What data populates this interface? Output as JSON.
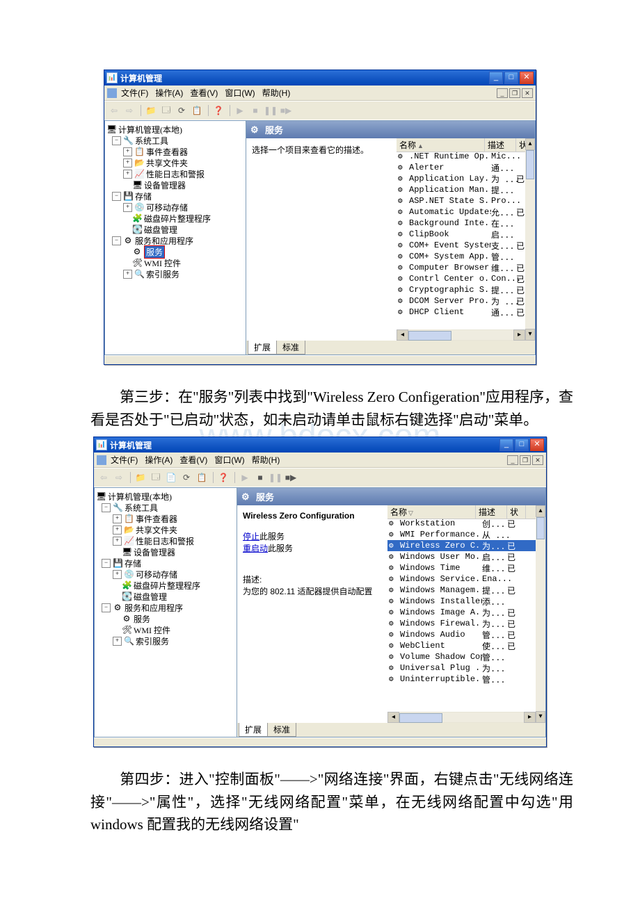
{
  "watermark": "www.bdocx.com",
  "window1": {
    "title": "计算机管理",
    "menus": [
      "文件(F)",
      "操作(A)",
      "查看(V)",
      "窗口(W)",
      "帮助(H)"
    ],
    "tree": {
      "root": "计算机管理(本地)",
      "sysTools": "系统工具",
      "eventViewer": "事件查看器",
      "sharedFolders": "共享文件夹",
      "perfLogs": "性能日志和警报",
      "devMgr": "设备管理器",
      "storage": "存储",
      "removable": "可移动存储",
      "defrag": "磁盘碎片整理程序",
      "diskMgmt": "磁盘管理",
      "svcApps": "服务和应用程序",
      "services": "服务",
      "wmi": "WMI 控件",
      "indexing": "索引服务"
    },
    "servicesPanel": {
      "heading": "服务",
      "hint": "选择一个项目来查看它的描述。",
      "cols": {
        "name": "名称",
        "desc": "描述",
        "stat": "状"
      },
      "rows": [
        {
          "n": ".NET Runtime Op...",
          "d": "Mic...",
          "s": ""
        },
        {
          "n": "Alerter",
          "d": "通...",
          "s": ""
        },
        {
          "n": "Application Lay...",
          "d": "为 ...",
          "s": "已"
        },
        {
          "n": "Application Man...",
          "d": "提...",
          "s": ""
        },
        {
          "n": "ASP.NET State S...",
          "d": "Pro...",
          "s": ""
        },
        {
          "n": "Automatic Updates",
          "d": "允...",
          "s": "已"
        },
        {
          "n": "Background Inte...",
          "d": "在...",
          "s": ""
        },
        {
          "n": "ClipBook",
          "d": "启...",
          "s": ""
        },
        {
          "n": "COM+ Event System",
          "d": "支...",
          "s": "已"
        },
        {
          "n": "COM+ System App...",
          "d": "管...",
          "s": ""
        },
        {
          "n": "Computer Browser",
          "d": "维...",
          "s": "已"
        },
        {
          "n": "Contrl Center o...",
          "d": "Con...",
          "s": "已"
        },
        {
          "n": "Cryptographic S...",
          "d": "提...",
          "s": "已"
        },
        {
          "n": "DCOM Server Pro...",
          "d": "为 ...",
          "s": "已"
        },
        {
          "n": "DHCP Client",
          "d": "通...",
          "s": "已"
        }
      ],
      "tabs": {
        "ext": "扩展",
        "std": "标准"
      }
    }
  },
  "para3": "第三步：在\"服务\"列表中找到\"Wireless Zero Configeration\"应用程序，查看是否处于\"已启动\"状态，如未启动请单击鼠标右键选择\"启动\"菜单。",
  "window2": {
    "title": "计算机管理",
    "menus": [
      "文件(F)",
      "操作(A)",
      "查看(V)",
      "窗口(W)",
      "帮助(H)"
    ],
    "servicesPanel": {
      "heading": "服务",
      "selTitle": "Wireless Zero Configuration",
      "stopLink": "停止",
      "stopSuffix": "此服务",
      "restartLink": "重启动",
      "restartSuffix": "此服务",
      "descLabel": "描述:",
      "descText": "为您的 802.11 适配器提供自动配置",
      "cols": {
        "name": "名称",
        "desc": "描述",
        "stat": "状"
      },
      "rows": [
        {
          "n": "Workstation",
          "d": "创...",
          "s": "已"
        },
        {
          "n": "WMI Performance...",
          "d": "从 ...",
          "s": ""
        },
        {
          "n": "Wireless Zero C...",
          "d": "为...",
          "s": "已",
          "sel": true
        },
        {
          "n": "Windows User Mo...",
          "d": "启...",
          "s": "已"
        },
        {
          "n": "Windows Time",
          "d": "维...",
          "s": "已"
        },
        {
          "n": "Windows Service...",
          "d": "Ena...",
          "s": ""
        },
        {
          "n": "Windows Managem...",
          "d": "提...",
          "s": "已"
        },
        {
          "n": "Windows Installer",
          "d": "添...",
          "s": ""
        },
        {
          "n": "Windows Image A...",
          "d": "为...",
          "s": "已"
        },
        {
          "n": "Windows Firewal...",
          "d": "为...",
          "s": "已"
        },
        {
          "n": "Windows Audio",
          "d": "管...",
          "s": "已"
        },
        {
          "n": "WebClient",
          "d": "使...",
          "s": "已"
        },
        {
          "n": "Volume Shadow Copy",
          "d": "管...",
          "s": ""
        },
        {
          "n": "Universal Plug ...",
          "d": "为...",
          "s": ""
        },
        {
          "n": "Uninterruptible...",
          "d": "管...",
          "s": ""
        }
      ],
      "tabs": {
        "ext": "扩展",
        "std": "标准"
      }
    }
  },
  "para4": "第四步：进入\"控制面板\"——>\"网络连接\"界面，右键点击\"无线网络连接\"——>\"属性\"，选择\"无线网络配置\"菜单，在无线网络配置中勾选\"用 windows 配置我的无线网络设置\""
}
